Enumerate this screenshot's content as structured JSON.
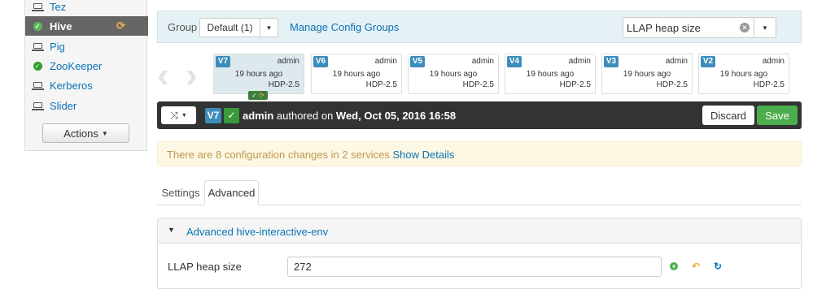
{
  "sidebar": {
    "items": [
      {
        "label": "Tez",
        "icon": "laptop-icon"
      },
      {
        "label": "Hive",
        "icon": "check-circle-icon",
        "active": true
      },
      {
        "label": "Pig",
        "icon": "laptop-icon"
      },
      {
        "label": "ZooKeeper",
        "icon": "check-circle-icon"
      },
      {
        "label": "Kerberos",
        "icon": "laptop-icon"
      },
      {
        "label": "Slider",
        "icon": "laptop-icon"
      }
    ],
    "actions_label": "Actions"
  },
  "groupbar": {
    "group_label": "Group",
    "group_value": "Default (1)",
    "manage_link": "Manage Config Groups",
    "filter_value": "LLAP heap size"
  },
  "versions": [
    {
      "tag": "V7",
      "author": "admin",
      "time": "19 hours ago",
      "stack": "HDP-2.5",
      "current": true
    },
    {
      "tag": "V6",
      "author": "admin",
      "time": "19 hours ago",
      "stack": "HDP-2.5"
    },
    {
      "tag": "V5",
      "author": "admin",
      "time": "19 hours ago",
      "stack": "HDP-2.5"
    },
    {
      "tag": "V4",
      "author": "admin",
      "time": "19 hours ago",
      "stack": "HDP-2.5"
    },
    {
      "tag": "V3",
      "author": "admin",
      "time": "19 hours ago",
      "stack": "HDP-2.5"
    },
    {
      "tag": "V2",
      "author": "admin",
      "time": "19 hours ago",
      "stack": "HDP-2.5"
    }
  ],
  "darkbar": {
    "version_tag": "V7",
    "author": "admin",
    "authored_text": " authored on ",
    "date": "Wed, Oct 05, 2016 16:58",
    "discard_label": "Discard",
    "save_label": "Save"
  },
  "warning": {
    "text": "There are 8 configuration changes in 2 services ",
    "link": "Show Details"
  },
  "tabs": {
    "settings": "Settings",
    "advanced": "Advanced"
  },
  "panel": {
    "title": "Advanced hive-interactive-env",
    "property_label": "LLAP heap size",
    "property_value": "272"
  },
  "colors": {
    "accent": "#0a73b7",
    "success": "#4cae4c",
    "warning": "#f0ad4e",
    "version_tag": "#3c8dbc"
  }
}
